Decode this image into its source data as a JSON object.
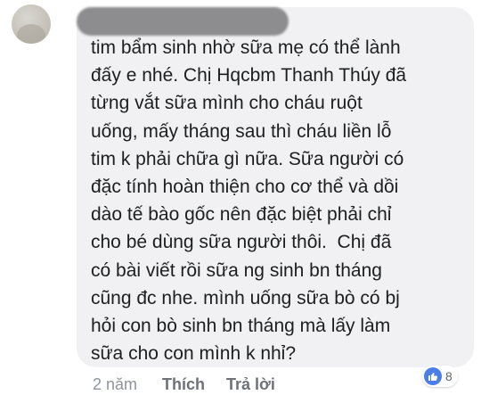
{
  "comment": {
    "author_redacted": true,
    "text": "tim bẩm sinh nhờ sữa mẹ có thể lành\nđấy e nhé. Chị Hqcbm Thanh Thúy đã\ntừng vắt sữa mình cho cháu ruột\nuống, mấy tháng sau thì cháu liền lỗ\ntim k phải chữa gì nữa. Sữa người có\nđặc tính hoàn thiện cho cơ thể và dồi\ndào tế bào gốc nên đặc biệt phải chỉ\ncho bé dùng sữa người thôi.  Chị đã\ncó bài viết rồi sữa ng sinh bn tháng\ncũng đc nhe. mình uống sữa bò có bj\nhỏi con bò sinh bn tháng mà lấy làm\nsữa cho con mình k nhỉ?"
  },
  "reactions": {
    "icon": "like-icon",
    "count": "8",
    "color": "#4c7ee8"
  },
  "actions": {
    "time": "2 năm",
    "like_label": "Thích",
    "reply_label": "Trả lời"
  },
  "colors": {
    "bubble": "#f1f1f3",
    "text": "#1c1e21",
    "meta": "#90949c"
  }
}
